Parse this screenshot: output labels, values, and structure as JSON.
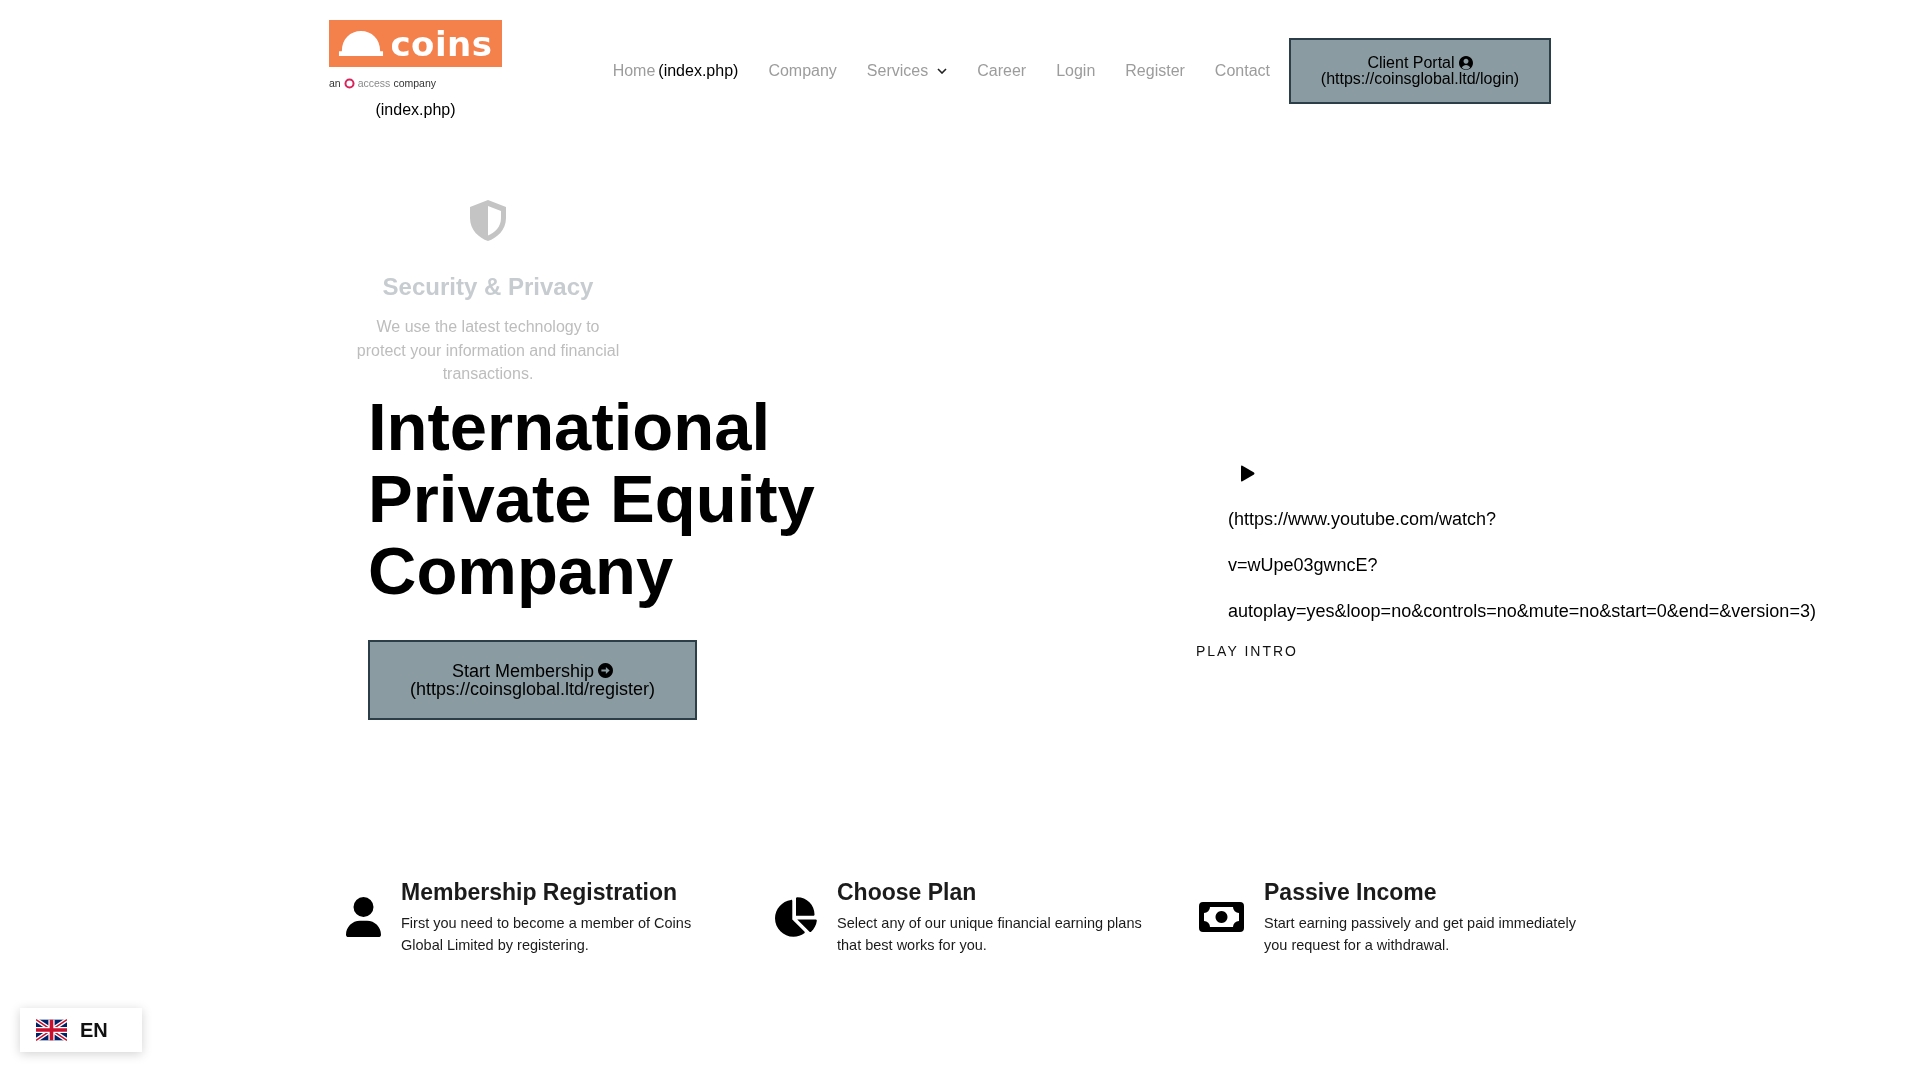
{
  "header": {
    "logo": {
      "wordmark": "coins",
      "tagline": {
        "prefix": "an",
        "brand": "access",
        "suffix": "company"
      },
      "link_text": "(index.php)"
    },
    "nav": [
      {
        "label": "Home",
        "link_text": "(index.php)",
        "has_menu": false
      },
      {
        "label": "Company",
        "has_menu": false
      },
      {
        "label": "Services",
        "has_menu": true
      },
      {
        "label": "Career",
        "has_menu": false
      },
      {
        "label": "Login",
        "has_menu": false
      },
      {
        "label": "Register",
        "has_menu": false
      },
      {
        "label": "Contact",
        "has_menu": false
      }
    ],
    "client_portal": {
      "label": "Client Portal",
      "link_text": "(https://coinsglobal.ltd/login)"
    }
  },
  "hero": {
    "slide": {
      "title": "Security & Privacy",
      "text": "We use the latest technology to protect your information and financial transactions."
    },
    "heading": "International Private Equity Company",
    "cta": {
      "label": "Start Membership",
      "link_text": "(https://coinsglobal.ltd/register)"
    },
    "video": {
      "link_lines": [
        "(https://www.youtube.com/watch?",
        "v=wUpe03gwncE?",
        "autoplay=yes&loop=no&controls=no&mute=no&start=0&end=&version=3)"
      ],
      "caption": "PLAY INTRO"
    }
  },
  "features": [
    {
      "title": "Membership Registration",
      "text": "First you need to become a member of Coins Global Limited by registering."
    },
    {
      "title": "Choose Plan",
      "text": "Select any of our unique financial earning plans that best works for you."
    },
    {
      "title": "Passive Income",
      "text": "Start earning passively and get paid immediately you request for a withdrawal."
    }
  ],
  "language": {
    "code": "EN"
  }
}
